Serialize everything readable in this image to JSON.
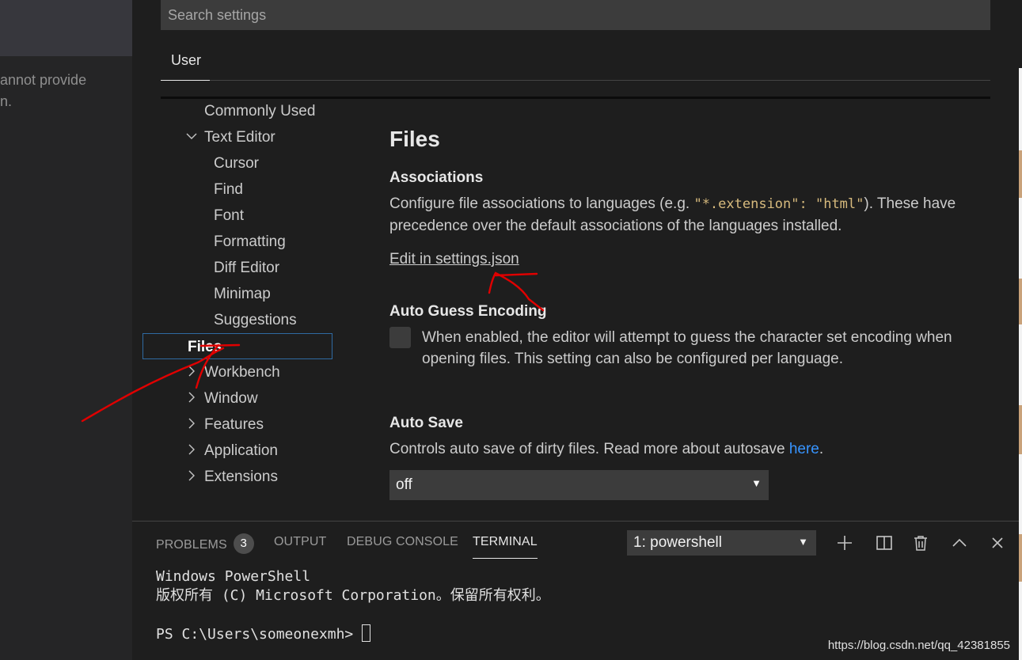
{
  "left_panel": {
    "message": "annot provide\nn."
  },
  "search": {
    "placeholder": "Search settings"
  },
  "scope_tab": "User",
  "toc": [
    {
      "label": "Commonly Used",
      "level": 0,
      "chevron": ""
    },
    {
      "label": "Text Editor",
      "level": 0,
      "chevron": "expanded"
    },
    {
      "label": "Cursor",
      "level": 1,
      "chevron": ""
    },
    {
      "label": "Find",
      "level": 1,
      "chevron": ""
    },
    {
      "label": "Font",
      "level": 1,
      "chevron": ""
    },
    {
      "label": "Formatting",
      "level": 1,
      "chevron": ""
    },
    {
      "label": "Diff Editor",
      "level": 1,
      "chevron": ""
    },
    {
      "label": "Minimap",
      "level": 1,
      "chevron": ""
    },
    {
      "label": "Suggestions",
      "level": 1,
      "chevron": ""
    },
    {
      "label": "Files",
      "level": 1,
      "chevron": "",
      "selected": true
    },
    {
      "label": "Workbench",
      "level": 0,
      "chevron": "collapsed"
    },
    {
      "label": "Window",
      "level": 0,
      "chevron": "collapsed"
    },
    {
      "label": "Features",
      "level": 0,
      "chevron": "collapsed"
    },
    {
      "label": "Application",
      "level": 0,
      "chevron": "collapsed"
    },
    {
      "label": "Extensions",
      "level": 0,
      "chevron": "collapsed"
    }
  ],
  "content": {
    "section_title": "Files",
    "associations": {
      "title": "Associations",
      "desc_before": "Configure file associations to languages (e.g. ",
      "desc_code": "\"*.extension\": \"html\"",
      "desc_after": "). These have precedence over the default associations of the languages installed.",
      "link": "Edit in settings.json"
    },
    "auto_guess": {
      "title": "Auto Guess Encoding",
      "desc": "When enabled, the editor will attempt to guess the character set encoding when opening files. This setting can also be configured per language.",
      "checked": false
    },
    "auto_save": {
      "title": "Auto Save",
      "desc_before": "Controls auto save of dirty files. Read more about autosave ",
      "link": "here",
      "desc_after": ".",
      "value": "off"
    }
  },
  "panel": {
    "tabs": {
      "problems": "PROBLEMS",
      "output": "OUTPUT",
      "debug": "DEBUG CONSOLE",
      "terminal": "TERMINAL"
    },
    "problems_count": "3",
    "terminal_select": "1: powershell",
    "terminal_lines": {
      "line1": "Windows PowerShell",
      "line2": "版权所有 (C) Microsoft Corporation。保留所有权利。",
      "prompt": "PS C:\\Users\\someonexmh> "
    },
    "icons": [
      "plus-icon",
      "split-icon",
      "trash-icon",
      "chevron-up-icon",
      "close-icon"
    ]
  },
  "watermark": "https://blog.csdn.net/qq_42381855",
  "colors": {
    "accent_link": "#3794ff",
    "annotation": "#e00000",
    "selection_border": "#2f6aa2"
  }
}
